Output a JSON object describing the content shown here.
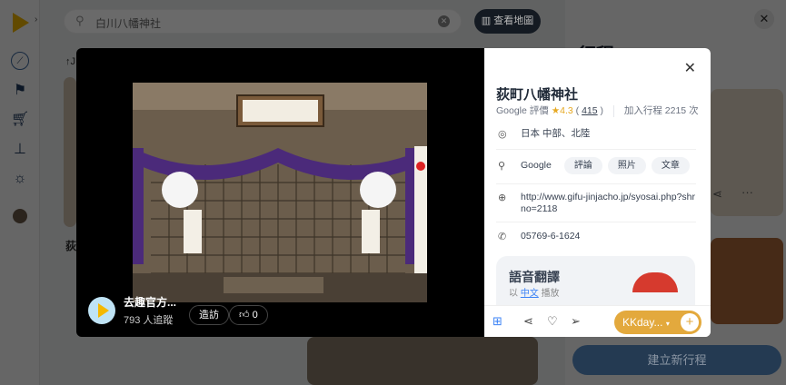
{
  "search": {
    "value": "白川八幡神社",
    "map_button": "查看地圖"
  },
  "right_panel": {
    "title": "行程",
    "new_trip_button": "建立新行程"
  },
  "background": {
    "card_title_fragment": "荻",
    "sort_fragment": "↑J"
  },
  "modal": {
    "author": {
      "name": "去趣官方...",
      "followers": "793 人追蹤",
      "visit_button": "造訪",
      "like_count": "0"
    },
    "place": {
      "title": "荻町八幡神社",
      "rating_label": "Google 評價",
      "rating": "4.3",
      "review_count": "415",
      "added": "加入行程 2215 次",
      "location": "日本 中部、北陸",
      "google_label": "Google",
      "chips": [
        "評論",
        "照片",
        "文章"
      ],
      "website": "http://www.gifu-jinjacho.jp/syosai.php?shrno=2118",
      "phone": "05769-6-1624",
      "voice": {
        "title": "語音翻譯",
        "prefix": "以",
        "language": "中文",
        "suffix": "播放"
      },
      "trip_select": "KKday..."
    }
  },
  "colors": {
    "accent": "#e3a93d",
    "dark_button": "#1f2937",
    "new_trip": "#2d4e73"
  }
}
